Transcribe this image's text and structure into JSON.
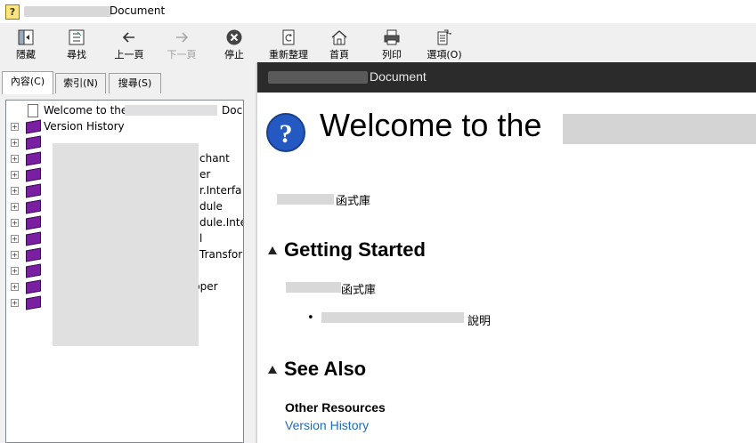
{
  "window": {
    "title": "Document"
  },
  "toolbar": {
    "hide": "隱藏",
    "locate": "尋找",
    "back": "上一頁",
    "forward": "下一頁",
    "stop": "停止",
    "refresh": "重新整理",
    "home": "首頁",
    "print": "列印",
    "options": "選項(O)"
  },
  "tabs": {
    "contents": "內容(C)",
    "index": "索引(N)",
    "search": "搜尋(S)"
  },
  "tree": {
    "welcome": "Welcome to the",
    "welcome_tail": "Doc",
    "version_history": "Version History",
    "frag_chant": "chant",
    "frag_er": "er",
    "frag_interfa": "r.Interfa",
    "frag_dule": "dule",
    "frag_dule_inte": "dule.Inte",
    "frag_l": "l",
    "frag_transfor": "Transfor",
    "frag_pper": "pper"
  },
  "doc": {
    "header": "Document",
    "title": "Welcome to the",
    "library_desc": "函式庫",
    "getting_started": "Getting Started",
    "gs_library": "函式庫",
    "gs_bullet_tail": "說明",
    "see_also": "See Also",
    "other_resources": "Other Resources",
    "version_history_link": "Version History"
  }
}
